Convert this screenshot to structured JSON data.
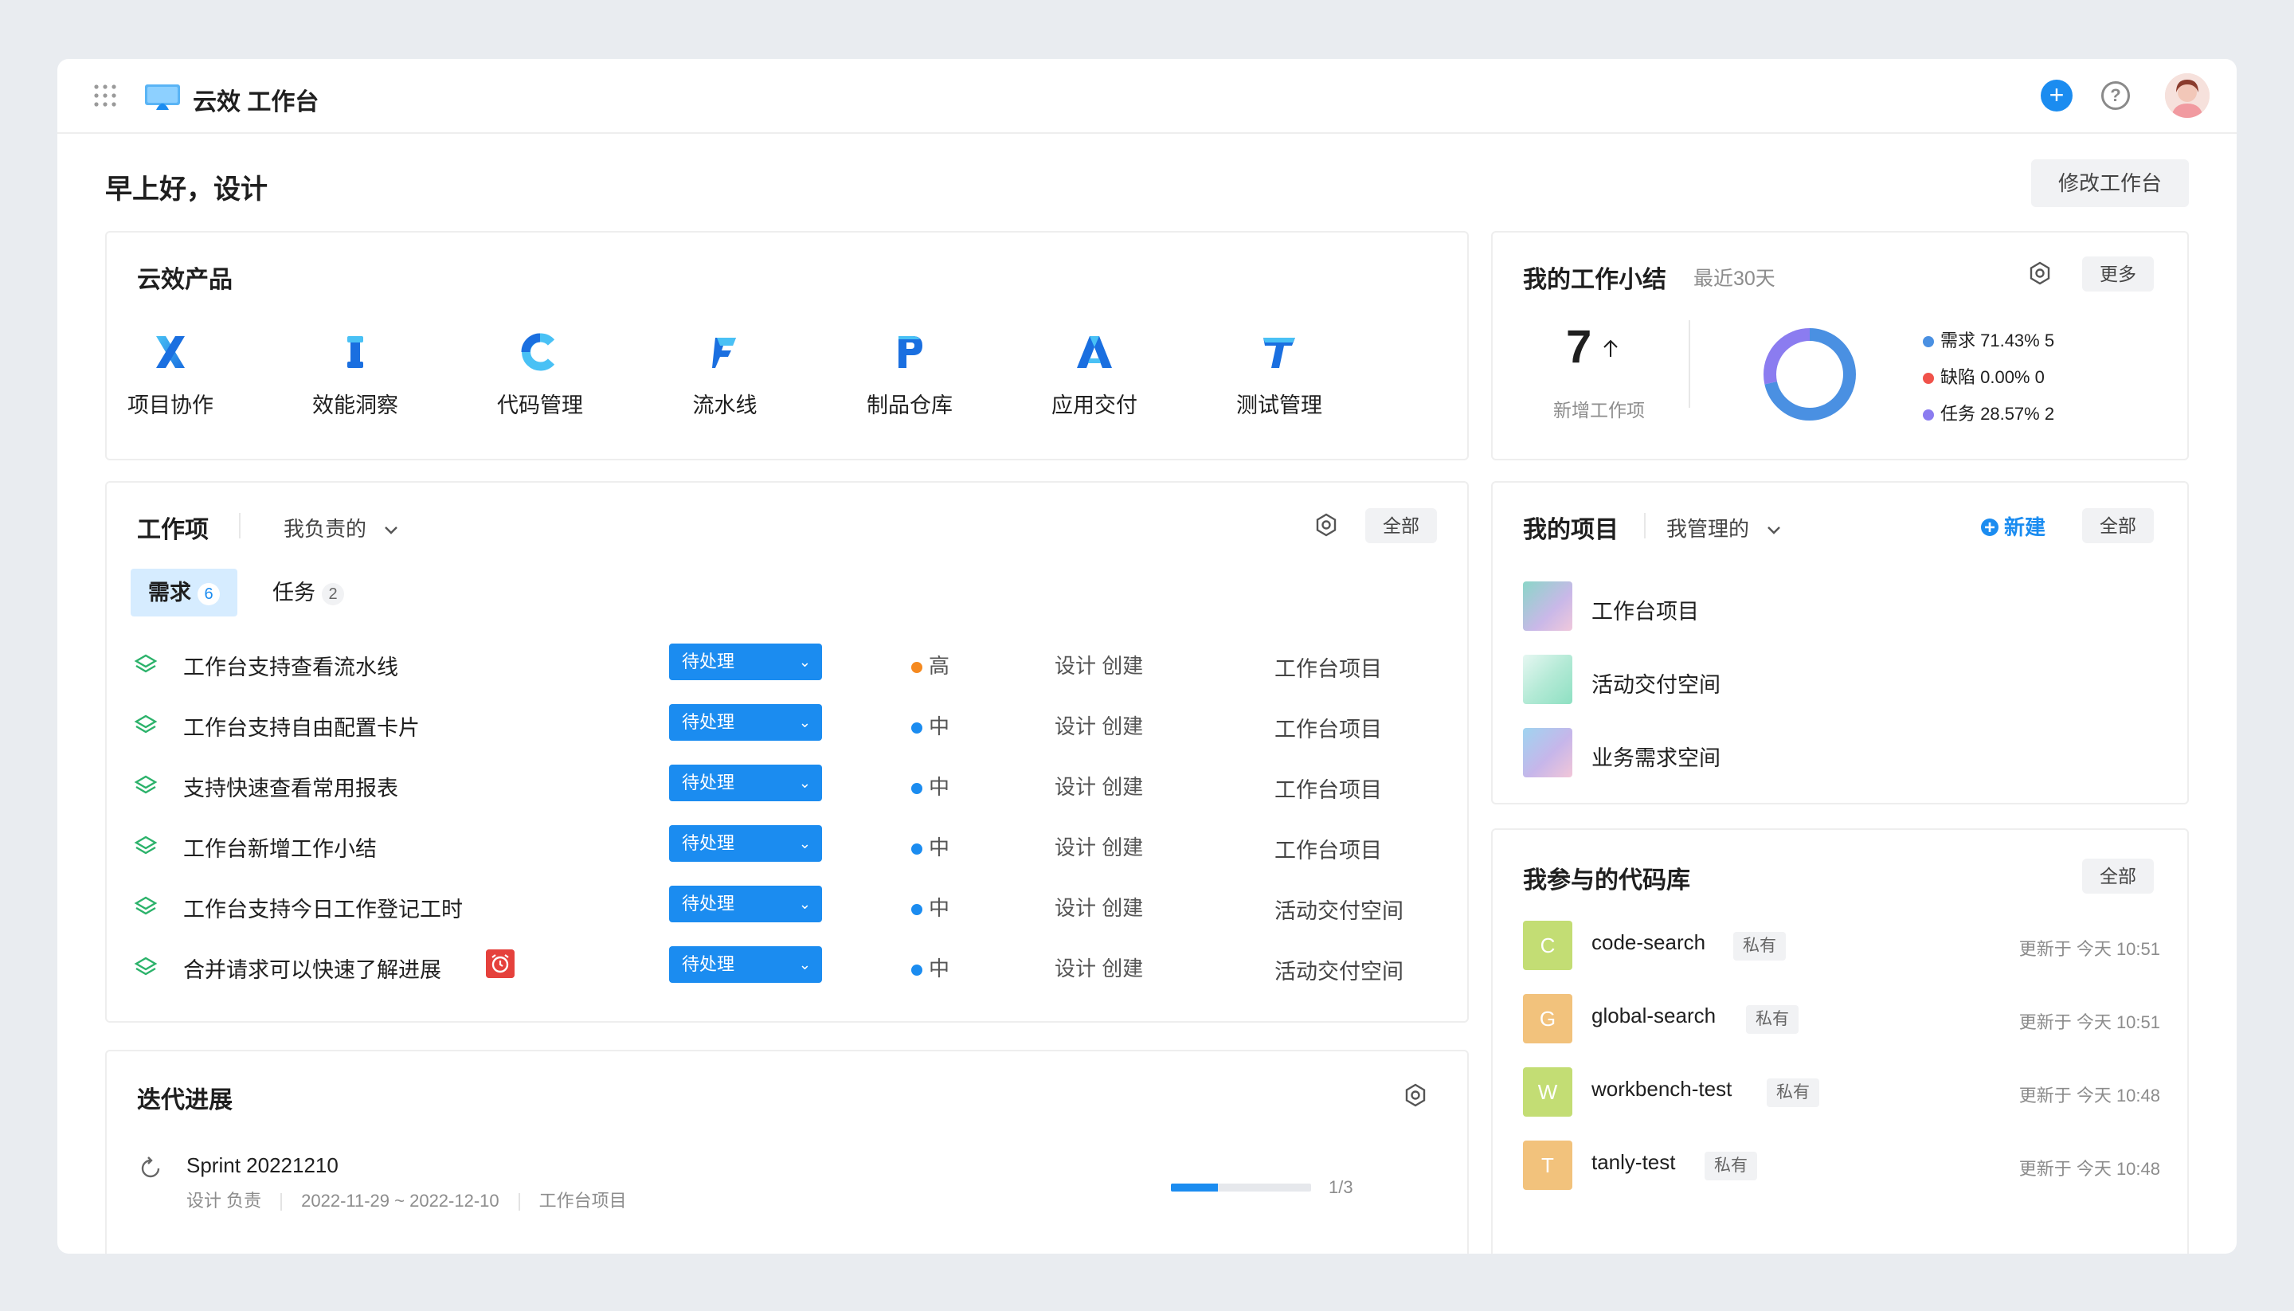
{
  "topbar": {
    "app_title": "云效 工作台"
  },
  "greeting": "早上好，设计",
  "edit_button": "修改工作台",
  "products": {
    "title": "云效产品",
    "items": [
      {
        "label": "项目协作",
        "letter": "X"
      },
      {
        "label": "效能洞察",
        "letter": "I"
      },
      {
        "label": "代码管理",
        "letter": "C"
      },
      {
        "label": "流水线",
        "letter": "F"
      },
      {
        "label": "制品仓库",
        "letter": "P"
      },
      {
        "label": "应用交付",
        "letter": "A"
      },
      {
        "label": "测试管理",
        "letter": "T"
      }
    ]
  },
  "summary": {
    "title": "我的工作小结",
    "period": "最近30天",
    "more": "更多",
    "count": "7",
    "unit": "个",
    "count_label": "新增工作项",
    "donut": [
      {
        "name": "需求",
        "percent": 71.43,
        "count": 5,
        "color": "#4a90e2"
      },
      {
        "name": "缺陷",
        "percent": 0,
        "count": 0,
        "color": "#f0524a"
      },
      {
        "name": "任务",
        "percent": 28.57,
        "count": 2,
        "color": "#8b7cf0"
      }
    ],
    "legend": [
      {
        "text": "需求  71.43%  5"
      },
      {
        "text": "缺陷  0.00%  0"
      },
      {
        "text": "任务  28.57%  2"
      }
    ]
  },
  "work_items": {
    "title": "工作项",
    "filter": "我负责的",
    "all": "全部",
    "tabs": [
      {
        "label": "需求",
        "count": "6"
      },
      {
        "label": "任务",
        "count": "2"
      }
    ],
    "rows": [
      {
        "title": "工作台支持查看流水线",
        "status": "待处理",
        "priority": "高",
        "creator": "设计  创建",
        "project": "工作台项目"
      },
      {
        "title": "工作台支持自由配置卡片",
        "status": "待处理",
        "priority": "中",
        "creator": "设计  创建",
        "project": "工作台项目"
      },
      {
        "title": "支持快速查看常用报表",
        "status": "待处理",
        "priority": "中",
        "creator": "设计  创建",
        "project": "工作台项目"
      },
      {
        "title": "工作台新增工作小结",
        "status": "待处理",
        "priority": "中",
        "creator": "设计  创建",
        "project": "工作台项目"
      },
      {
        "title": "工作台支持今日工作登记工时",
        "status": "待处理",
        "priority": "中",
        "creator": "设计  创建",
        "project": "活动交付空间"
      },
      {
        "title": "合并请求可以快速了解进展",
        "status": "待处理",
        "priority": "中",
        "creator": "设计  创建",
        "project": "活动交付空间"
      }
    ]
  },
  "projects": {
    "title": "我的项目",
    "filter": "我管理的",
    "new": "新建",
    "all": "全部",
    "items": [
      {
        "name": "工作台项目"
      },
      {
        "name": "活动交付空间"
      },
      {
        "name": "业务需求空间"
      }
    ]
  },
  "repos": {
    "title": "我参与的代码库",
    "all": "全部",
    "items": [
      {
        "letter": "C",
        "name": "code-search",
        "tag": "私有",
        "updated": "更新于 今天 10:51",
        "color": "#b8d96a"
      },
      {
        "letter": "G",
        "name": "global-search",
        "tag": "私有",
        "updated": "更新于 今天 10:51",
        "color": "#f0c07a"
      },
      {
        "letter": "W",
        "name": "workbench-test",
        "tag": "私有",
        "updated": "更新于 今天 10:48",
        "color": "#b8d96a"
      },
      {
        "letter": "T",
        "name": "tanly-test",
        "tag": "私有",
        "updated": "更新于 今天 10:48",
        "color": "#f0c07a"
      }
    ]
  },
  "iteration": {
    "title": "迭代进展",
    "sprint": {
      "name": "Sprint 20221210",
      "owner": "设计 负责",
      "dates": "2022-11-29 ~ 2022-12-10",
      "project": "工作台项目",
      "progress_text": "1/3",
      "progress": 0.3333
    }
  }
}
